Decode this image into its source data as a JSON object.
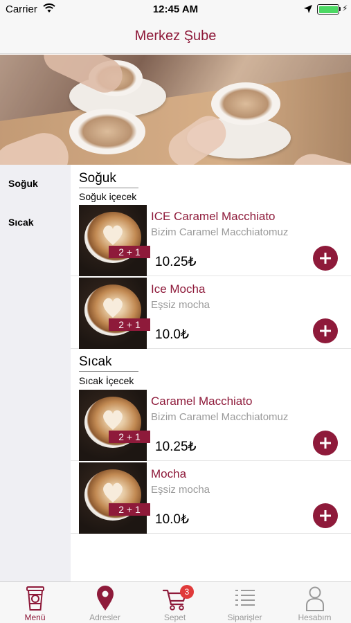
{
  "status_bar": {
    "carrier": "Carrier",
    "time": "12:45 AM",
    "battery_level": 1.0
  },
  "nav": {
    "title": "Merkez Şube"
  },
  "sidebar": {
    "categories": [
      {
        "label": "Soğuk"
      },
      {
        "label": "Sıcak"
      }
    ]
  },
  "sections": [
    {
      "title": "Soğuk",
      "subtitle": "Soğuk içecek",
      "products": [
        {
          "name": "ICE Caramel Macchiato",
          "description": "Bizim Caramel Macchiatomuz",
          "price": "10.25₺",
          "badge": "2 + 1"
        },
        {
          "name": "Ice Mocha",
          "description": "Eşsiz mocha",
          "price": "10.0₺",
          "badge": "2 + 1"
        }
      ]
    },
    {
      "title": "Sıcak",
      "subtitle": "Sıcak İçecek",
      "products": [
        {
          "name": "Caramel Macchiato",
          "description": "Bizim Caramel Macchiatomuz",
          "price": "10.25₺",
          "badge": "2 + 1"
        },
        {
          "name": "Mocha",
          "description": "Eşsiz mocha",
          "price": "10.0₺",
          "badge": "2 + 1"
        }
      ]
    }
  ],
  "tab_bar": {
    "tabs": [
      {
        "label": "Menü",
        "icon": "coffee-cup-icon",
        "active": true
      },
      {
        "label": "Adresler",
        "icon": "location-pin-icon",
        "active": false
      },
      {
        "label": "Sepet",
        "icon": "cart-icon",
        "active": false,
        "badge": "3"
      },
      {
        "label": "Siparişler",
        "icon": "list-icon",
        "active": false
      },
      {
        "label": "Hesabım",
        "icon": "user-icon",
        "active": false
      }
    ]
  },
  "colors": {
    "brand": "#8e1a3a",
    "sidebar_bg": "#efeff3",
    "badge_red": "#e03a3a",
    "inactive_tab": "#9a9a9a"
  }
}
